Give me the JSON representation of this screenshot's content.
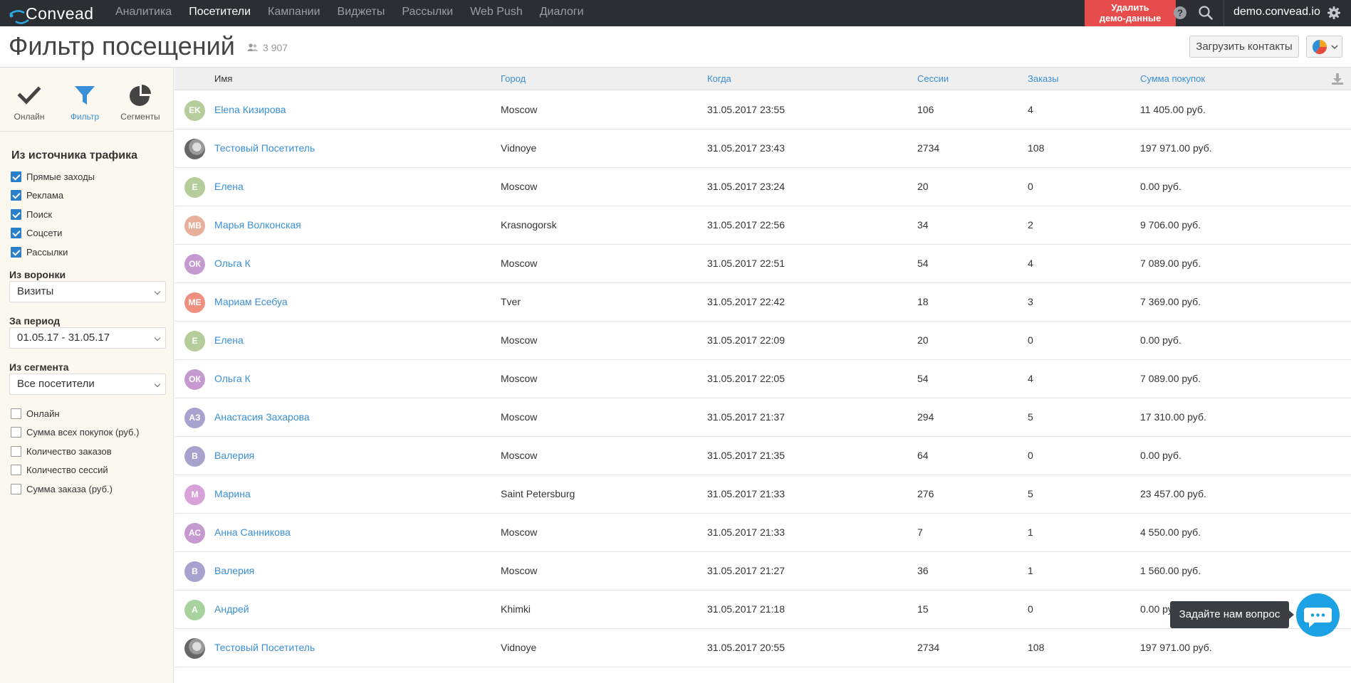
{
  "app": {
    "logo_text": "Convead",
    "nav": [
      "Аналитика",
      "Посетители",
      "Кампании",
      "Виджеты",
      "Рассылки",
      "Web Push",
      "Диалоги"
    ],
    "nav_active": "Посетители",
    "demo_button": "Удалить демо-данные",
    "demo_button_line1": "Удалить",
    "demo_button_line2": "демо-данные",
    "account": "demo.convead.io",
    "colors": {
      "topbar": "#2b2e33",
      "danger": "#e74c4c",
      "accent": "#3a8fd6",
      "sidebar": "#fbf8ef",
      "chat": "#1da1e5"
    }
  },
  "header": {
    "title": "Фильтр посещений",
    "count": "3 907",
    "upload_label": "Загрузить контакты"
  },
  "sidebar": {
    "modes": [
      {
        "label": "Онлайн",
        "icon": "checkmark-icon",
        "active": false
      },
      {
        "label": "Фильтр",
        "icon": "filter-icon",
        "active": true
      },
      {
        "label": "Сегменты",
        "icon": "pie-icon",
        "active": false
      }
    ],
    "traffic_heading": "Из источника трафика",
    "traffic_sources": [
      {
        "label": "Прямые заходы",
        "checked": true
      },
      {
        "label": "Реклама",
        "checked": true
      },
      {
        "label": "Поиск",
        "checked": true
      },
      {
        "label": "Соцсети",
        "checked": true
      },
      {
        "label": "Рассылки",
        "checked": true
      }
    ],
    "funnel_label": "Из воронки",
    "funnel_value": "Визиты",
    "period_label": "За период",
    "period_value": "01.05.17 - 31.05.17",
    "segment_label": "Из сегмента",
    "segment_value": "Все посетители",
    "extra_filters": [
      {
        "label": "Онлайн",
        "checked": false
      },
      {
        "label": "Сумма всех покупок (руб.)",
        "checked": false
      },
      {
        "label": "Количество заказов",
        "checked": false
      },
      {
        "label": "Количество сессий",
        "checked": false
      },
      {
        "label": "Сумма заказа (руб.)",
        "checked": false
      }
    ]
  },
  "table": {
    "columns": [
      "Имя",
      "Город",
      "Когда",
      "Сессии",
      "Заказы",
      "Сумма покупок"
    ],
    "rows": [
      {
        "initials": "EK",
        "color": "#b5cc9b",
        "name": "Elena Кизирова",
        "city": "Moscow",
        "when": "31.05.2017 23:55",
        "sessions": "106",
        "orders": "4",
        "sum": "11 405.00 руб."
      },
      {
        "initials": "",
        "color": "photo",
        "name": "Тестовый Посетитель",
        "city": "Vidnoye",
        "when": "31.05.2017 23:43",
        "sessions": "2734",
        "orders": "108",
        "sum": "197 971.00 руб."
      },
      {
        "initials": "Е",
        "color": "#b5cc9b",
        "name": "Елена",
        "city": "Moscow",
        "when": "31.05.2017 23:24",
        "sessions": "20",
        "orders": "0",
        "sum": "0.00 руб."
      },
      {
        "initials": "МВ",
        "color": "#e8b09a",
        "name": "Марья Волконская",
        "city": "Krasnogorsk",
        "when": "31.05.2017 22:56",
        "sessions": "34",
        "orders": "2",
        "sum": "9 706.00 руб."
      },
      {
        "initials": "ОК",
        "color": "#c49ad1",
        "name": "Ольга К",
        "city": "Moscow",
        "when": "31.05.2017 22:51",
        "sessions": "54",
        "orders": "4",
        "sum": "7 089.00 руб."
      },
      {
        "initials": "МЕ",
        "color": "#ef8f80",
        "name": "Мариам Есебуа",
        "city": "Tver",
        "when": "31.05.2017 22:42",
        "sessions": "18",
        "orders": "3",
        "sum": "7 369.00 руб."
      },
      {
        "initials": "Е",
        "color": "#b5cc9b",
        "name": "Елена",
        "city": "Moscow",
        "when": "31.05.2017 22:09",
        "sessions": "20",
        "orders": "0",
        "sum": "0.00 руб."
      },
      {
        "initials": "ОК",
        "color": "#c49ad1",
        "name": "Ольга К",
        "city": "Moscow",
        "when": "31.05.2017 22:05",
        "sessions": "54",
        "orders": "4",
        "sum": "7 089.00 руб."
      },
      {
        "initials": "АЗ",
        "color": "#a6a4cf",
        "name": "Анастасия Захарова",
        "city": "Moscow",
        "when": "31.05.2017 21:37",
        "sessions": "294",
        "orders": "5",
        "sum": "17 310.00 руб."
      },
      {
        "initials": "В",
        "color": "#a6a4cf",
        "name": "Валерия",
        "city": "Moscow",
        "when": "31.05.2017 21:35",
        "sessions": "64",
        "orders": "0",
        "sum": "0.00 руб."
      },
      {
        "initials": "М",
        "color": "#d8a2d8",
        "name": "Марина",
        "city": "Saint Petersburg",
        "when": "31.05.2017 21:33",
        "sessions": "276",
        "orders": "5",
        "sum": "23 457.00 руб."
      },
      {
        "initials": "АС",
        "color": "#c49ad1",
        "name": "Анна Санникова",
        "city": "Moscow",
        "when": "31.05.2017 21:33",
        "sessions": "7",
        "orders": "1",
        "sum": "4 550.00 руб."
      },
      {
        "initials": "В",
        "color": "#a6a4cf",
        "name": "Валерия",
        "city": "Moscow",
        "when": "31.05.2017 21:27",
        "sessions": "36",
        "orders": "1",
        "sum": "1 560.00 руб."
      },
      {
        "initials": "А",
        "color": "#a9d39e",
        "name": "Андрей",
        "city": "Khimki",
        "when": "31.05.2017 21:18",
        "sessions": "15",
        "orders": "0",
        "sum": "0.00 руб."
      },
      {
        "initials": "",
        "color": "photo",
        "name": "Тестовый Посетитель",
        "city": "Vidnoye",
        "when": "31.05.2017 20:55",
        "sessions": "2734",
        "orders": "108",
        "sum": "197 971.00 руб."
      }
    ]
  },
  "chat": {
    "tooltip": "Задайте нам вопрос"
  }
}
